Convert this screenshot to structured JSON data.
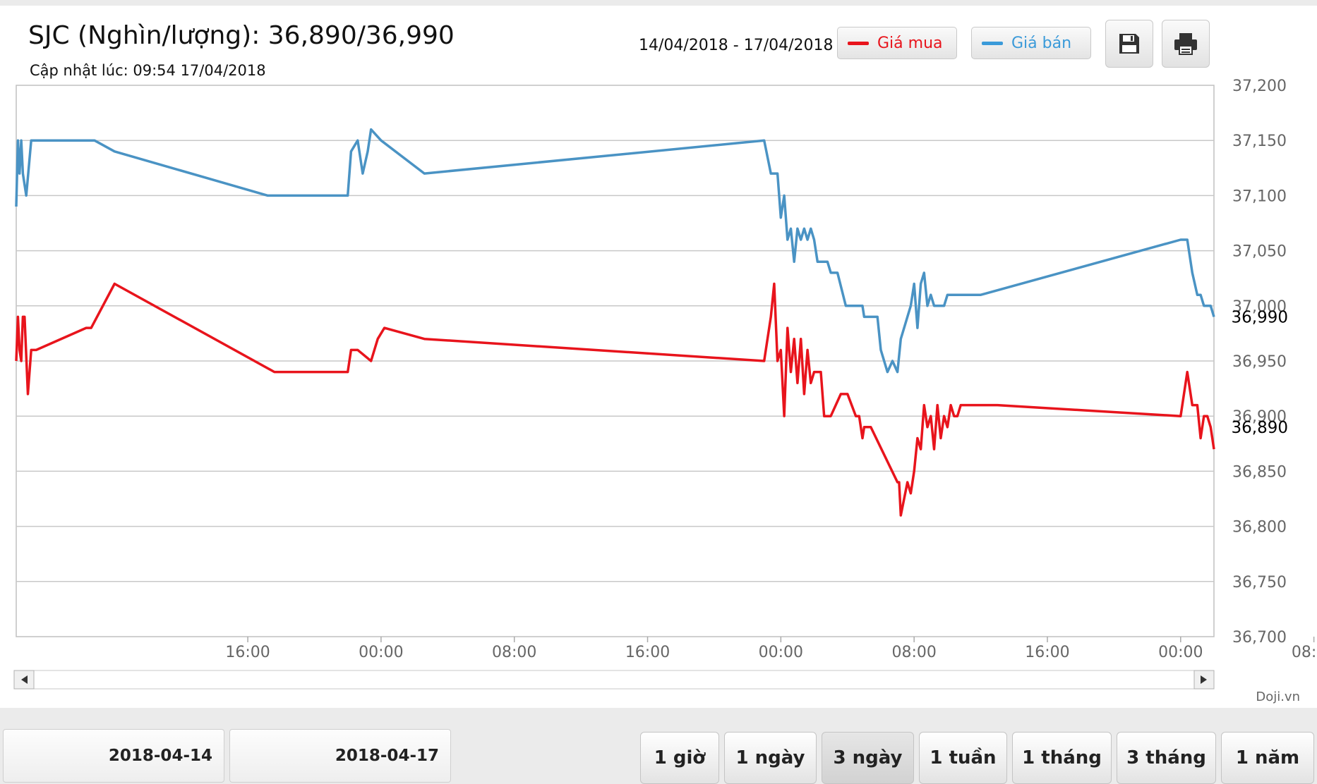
{
  "header": {
    "title": "SJC (Nghìn/lượng): 36,890/36,990",
    "updated": "Cập nhật lúc: 09:54 17/04/2018",
    "date_range": "14/04/2018 - 17/04/2018"
  },
  "legend": {
    "buy_label": "Giá mua",
    "sell_label": "Giá bán"
  },
  "colors": {
    "buy": "#e8141c",
    "sell": "#4a93c4"
  },
  "toolbar": {
    "save_icon": "floppy-disk-icon",
    "print_icon": "printer-icon"
  },
  "brand": "Doji.vn",
  "navigator": {
    "left_arrow_icon": "arrow-left-icon",
    "right_arrow_icon": "arrow-right-icon"
  },
  "date_inputs": {
    "from": "2018-04-14",
    "to": "2018-04-17"
  },
  "range_buttons": [
    {
      "label": "1 giờ",
      "active": false
    },
    {
      "label": "1 ngày",
      "active": false
    },
    {
      "label": "3 ngày",
      "active": true
    },
    {
      "label": "1 tuần",
      "active": false
    },
    {
      "label": "1 tháng",
      "active": false
    },
    {
      "label": "3 tháng",
      "active": false
    },
    {
      "label": "1 năm",
      "active": false
    }
  ],
  "chart_data": {
    "type": "line",
    "title": "",
    "xlabel": "",
    "ylabel": "",
    "ylim": [
      36700,
      37200
    ],
    "y_ticks": [
      "36,700",
      "36,750",
      "36,800",
      "36,850",
      "36,900",
      "36,950",
      "37,000",
      "37,050",
      "37,100",
      "37,150",
      "37,200"
    ],
    "x_ticks": [
      "16:00",
      "00:00",
      "08:00",
      "16:00",
      "00:00",
      "08:00",
      "16:00",
      "00:00",
      "08:00"
    ],
    "x_range_hours": [
      -5.9,
      66.0
    ],
    "grid": true,
    "last_values": {
      "buy": "36,890",
      "sell": "36,990"
    },
    "series": [
      {
        "name": "Giá mua",
        "color": "#e8141c",
        "x": [
          -5.9,
          -5.8,
          -5.7,
          -5.6,
          -5.5,
          -5.4,
          -5.2,
          -5.0,
          -4.7,
          -1.7,
          -1.4,
          0.0,
          9.6,
          14.0,
          14.2,
          14.6,
          15.4,
          15.8,
          16.2,
          18.6,
          39.0,
          39.4,
          39.6,
          39.8,
          40.0,
          40.2,
          40.4,
          40.6,
          40.8,
          41.0,
          41.2,
          41.4,
          41.6,
          41.8,
          42.0,
          42.2,
          42.4,
          42.6,
          43.0,
          43.6,
          44.0,
          44.5,
          44.7,
          44.9,
          45.0,
          45.2,
          45.4,
          47.0,
          47.1,
          47.2,
          47.6,
          47.8,
          48.0,
          48.2,
          48.4,
          48.6,
          48.8,
          49.0,
          49.2,
          49.4,
          49.6,
          49.8,
          50.0,
          50.2,
          50.4,
          50.6,
          50.8,
          51.0,
          51.2,
          51.4,
          51.6,
          51.8,
          52.0,
          53.0,
          64.0,
          64.4,
          64.7,
          65.0,
          65.2,
          65.4,
          65.6,
          65.8,
          66.0
        ],
        "y": [
          36950,
          36990,
          36960,
          36950,
          36990,
          36990,
          36920,
          36960,
          36960,
          36980,
          36980,
          37020,
          36940,
          36940,
          36960,
          36960,
          36950,
          36970,
          36980,
          36970,
          36950,
          36990,
          37020,
          36950,
          36960,
          36900,
          36980,
          36940,
          36970,
          36930,
          36970,
          36920,
          36960,
          36930,
          36940,
          36940,
          36940,
          36900,
          36900,
          36920,
          36920,
          36900,
          36900,
          36880,
          36890,
          36890,
          36890,
          36840,
          36840,
          36810,
          36840,
          36830,
          36850,
          36880,
          36870,
          36910,
          36890,
          36900,
          36870,
          36910,
          36880,
          36900,
          36890,
          36910,
          36900,
          36900,
          36910,
          36910,
          36910,
          36910,
          36910,
          36910,
          36910,
          36910,
          36900,
          36940,
          36910,
          36910,
          36880,
          36900,
          36900,
          36890,
          36870
        ]
      },
      {
        "name": "Giá bán",
        "color": "#4a93c4",
        "x": [
          -5.9,
          -5.8,
          -5.7,
          -5.6,
          -5.5,
          -5.4,
          -5.3,
          -5.0,
          -4.8,
          -1.9,
          -1.2,
          0.0,
          9.2,
          14.0,
          14.2,
          14.6,
          14.9,
          15.2,
          15.4,
          16.0,
          18.6,
          39.0,
          39.4,
          39.8,
          40.0,
          40.2,
          40.4,
          40.6,
          40.8,
          41.0,
          41.2,
          41.4,
          41.6,
          41.8,
          42.0,
          42.2,
          42.4,
          42.8,
          43.0,
          43.4,
          43.9,
          44.0,
          44.9,
          45.0,
          45.8,
          46.0,
          46.4,
          46.7,
          47.0,
          47.2,
          47.6,
          47.8,
          48.0,
          48.2,
          48.4,
          48.6,
          48.8,
          49.0,
          49.2,
          49.4,
          49.6,
          49.8,
          50.0,
          50.2,
          50.6,
          51.0,
          52.0,
          64.0,
          64.4,
          64.7,
          65.0,
          65.2,
          65.4,
          65.6,
          65.8,
          66.0
        ],
        "y": [
          37090,
          37150,
          37120,
          37150,
          37120,
          37110,
          37100,
          37150,
          37150,
          37150,
          37150,
          37140,
          37100,
          37100,
          37140,
          37150,
          37120,
          37140,
          37160,
          37150,
          37120,
          37150,
          37120,
          37120,
          37080,
          37100,
          37060,
          37070,
          37040,
          37070,
          37060,
          37070,
          37060,
          37070,
          37060,
          37040,
          37040,
          37040,
          37030,
          37030,
          37000,
          37000,
          37000,
          36990,
          36990,
          36960,
          36940,
          36950,
          36940,
          36970,
          36990,
          37000,
          37020,
          36980,
          37020,
          37030,
          37000,
          37010,
          37000,
          37000,
          37000,
          37000,
          37010,
          37010,
          37010,
          37010,
          37010,
          37060,
          37060,
          37030,
          37010,
          37010,
          37000,
          37000,
          37000,
          36990
        ]
      }
    ]
  }
}
